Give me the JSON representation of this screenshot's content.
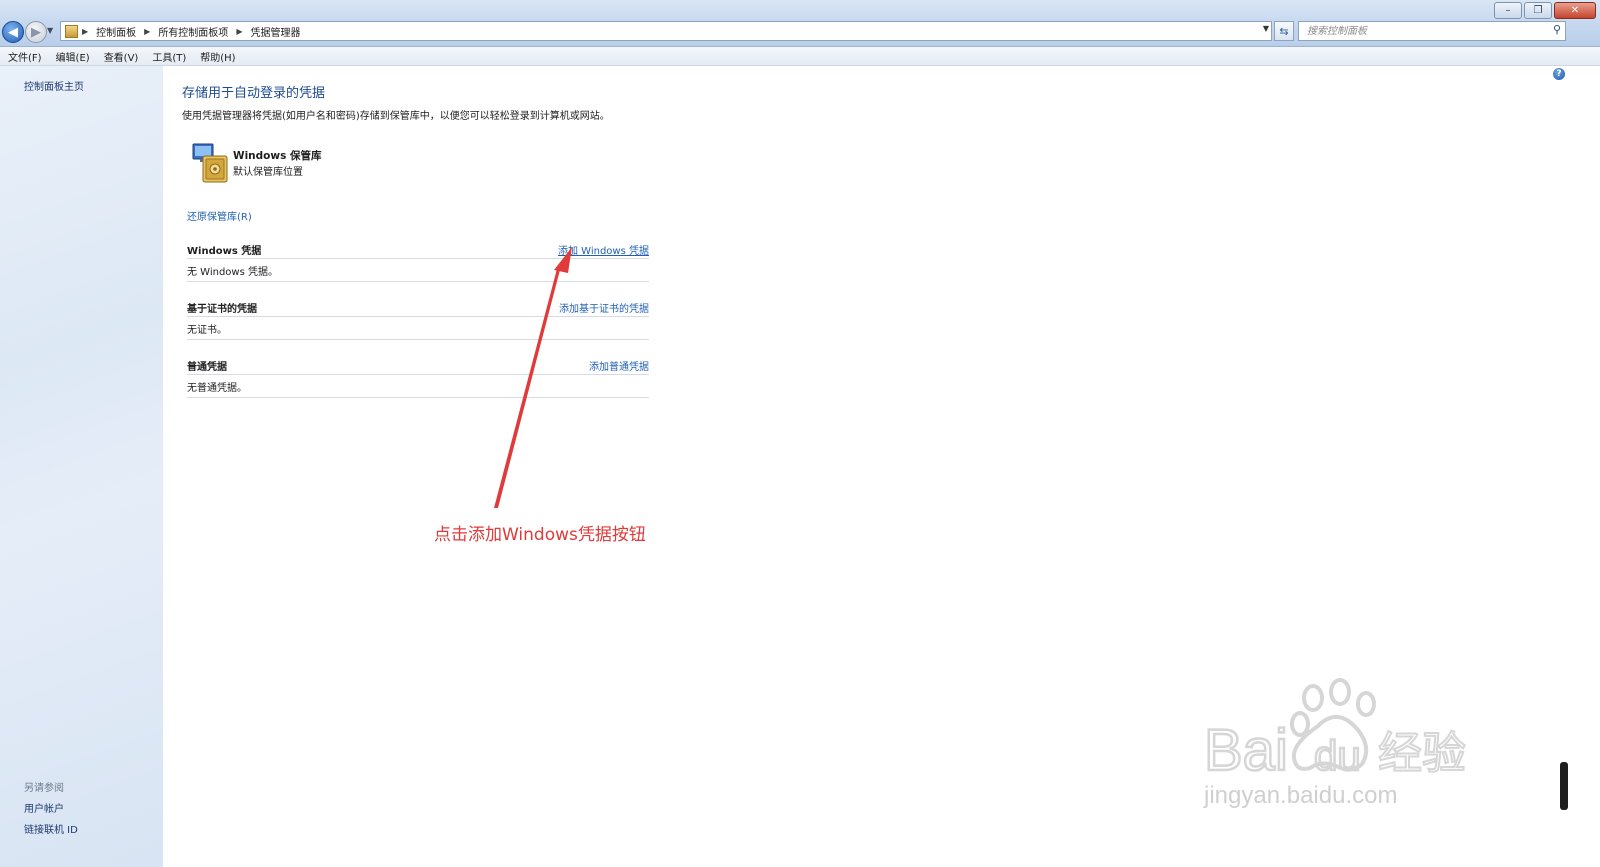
{
  "window": {
    "minimize_glyph": "–",
    "maximize_glyph": "❐",
    "close_glyph": "✕"
  },
  "address": {
    "breadcrumbs": [
      "控制面板",
      "所有控制面板项",
      "凭据管理器"
    ],
    "search_placeholder": "搜索控制面板"
  },
  "menu": [
    "文件(F)",
    "编辑(E)",
    "查看(V)",
    "工具(T)",
    "帮助(H)"
  ],
  "sidebar": {
    "home": "控制面板主页",
    "see_also": "另请参阅",
    "links": [
      "用户帐户",
      "链接联机 ID"
    ]
  },
  "main": {
    "title": "存储用于自动登录的凭据",
    "description": "使用凭据管理器将凭据(如用户名和密码)存储到保管库中，以便您可以轻松登录到计算机或网站。",
    "vault": {
      "name": "Windows 保管库",
      "subtitle": "默认保管库位置"
    },
    "restore_link": "还原保管库(R)",
    "sections": [
      {
        "title": "Windows 凭据",
        "action": "添加 Windows 凭据",
        "empty": "无 Windows 凭据。"
      },
      {
        "title": "基于证书的凭据",
        "action": "添加基于证书的凭据",
        "empty": "无证书。"
      },
      {
        "title": "普通凭据",
        "action": "添加普通凭据",
        "empty": "无普通凭据。"
      }
    ]
  },
  "annotation": {
    "text": "点击添加Windows凭据按钮",
    "color": "#e03a3a"
  },
  "watermark": {
    "brand": "Bai du 经验",
    "url": "jingyan.baidu.com"
  },
  "colors": {
    "link": "#1f5fb3",
    "title": "#1e4a92",
    "sidebar": "#e2ebf6"
  }
}
